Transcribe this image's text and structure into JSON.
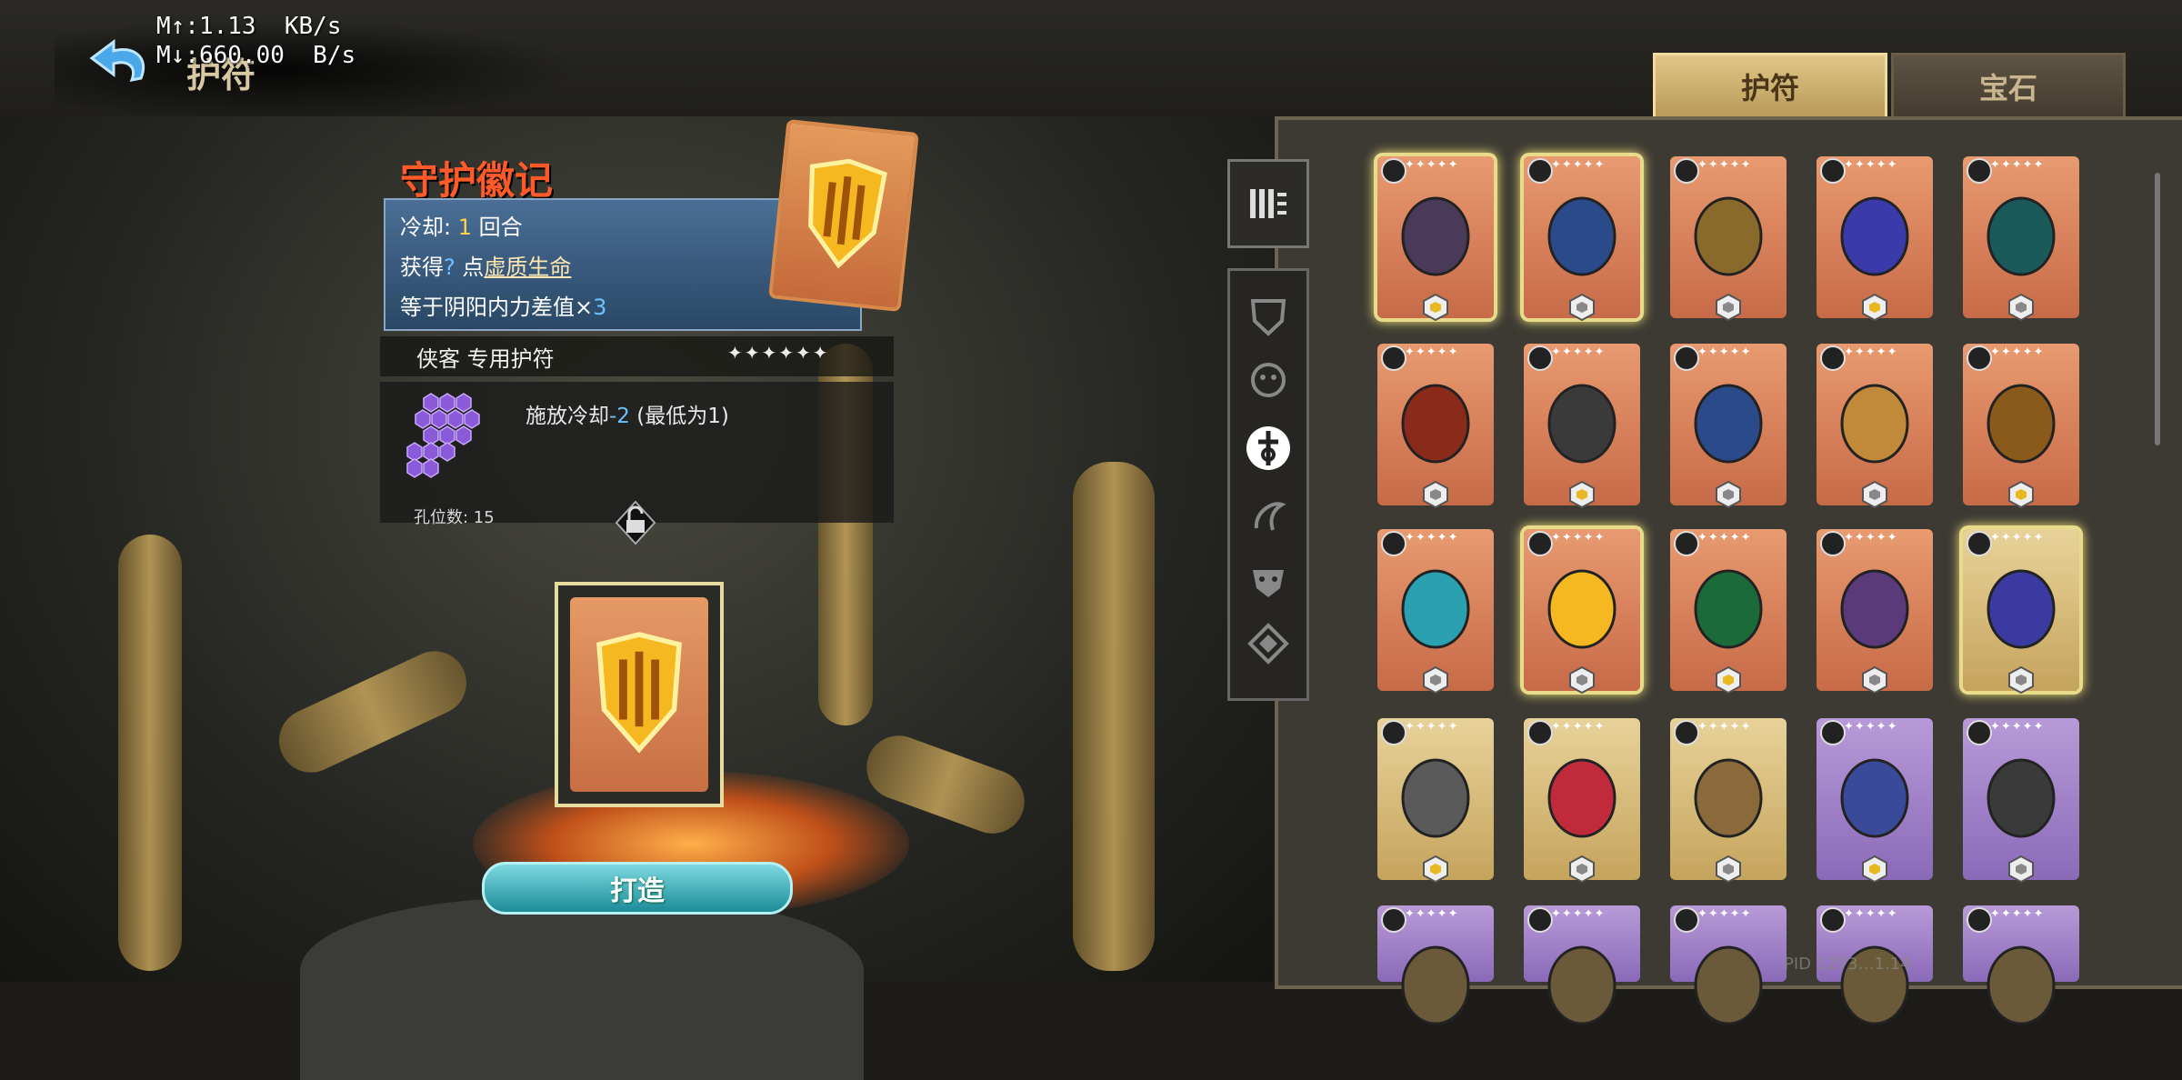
{
  "header": {
    "page_title": "护符",
    "net_up": "M↑:1.13  KB/s",
    "net_down": "M↓:660.00  B/s"
  },
  "tabs": [
    {
      "label": "护符",
      "active": true
    },
    {
      "label": "宝石",
      "active": false
    }
  ],
  "item": {
    "name": "守护徽记",
    "cooldown_label": "冷却:",
    "cooldown_value": "1",
    "cooldown_unit": "回合",
    "gain_label": "获得",
    "gain_value": "?",
    "gain_mid": "点",
    "gain_stat": "虚质生命",
    "equal_text": "等于阴阳内力差值×",
    "equal_value": "3",
    "owner": "侠客 专用护符",
    "stars": "✦✦✦✦✦✦",
    "socket_effect_prefix": "施放冷却",
    "socket_effect_value": "-2",
    "socket_effect_suffix": "(最低为1)",
    "slot_label": "孔位数: 15"
  },
  "forge_button": "打造",
  "filter_icons": [
    "all-filter-icon",
    "shield-class-icon",
    "beast-class-icon",
    "swordsman-class-icon",
    "musician-class-icon",
    "mask-class-icon",
    "diamond-class-icon"
  ],
  "grid": [
    {
      "name": "mask",
      "color": "orange",
      "selected": true
    },
    {
      "name": "blue-book",
      "color": "orange",
      "selected": true
    },
    {
      "name": "gold-helmet",
      "color": "orange",
      "selected": false
    },
    {
      "name": "glowing-tome",
      "color": "orange",
      "selected": false
    },
    {
      "name": "jade-pendant",
      "color": "orange",
      "selected": false
    },
    {
      "name": "red-vest",
      "color": "orange",
      "selected": false
    },
    {
      "name": "bead-necklace",
      "color": "orange",
      "selected": false
    },
    {
      "name": "blue-book-2",
      "color": "orange",
      "selected": false
    },
    {
      "name": "amber-necklace",
      "color": "orange",
      "selected": false
    },
    {
      "name": "gold-bracelet",
      "color": "orange",
      "selected": false
    },
    {
      "name": "teal-feather",
      "color": "orange",
      "selected": false
    },
    {
      "name": "guardian-emblem",
      "color": "orange",
      "selected": true
    },
    {
      "name": "green-token",
      "color": "orange",
      "selected": false
    },
    {
      "name": "purple-skull",
      "color": "orange",
      "selected": false
    },
    {
      "name": "crow-book",
      "color": "gold",
      "selected": true
    },
    {
      "name": "toad",
      "color": "gold",
      "selected": false
    },
    {
      "name": "life-ring",
      "color": "gold",
      "selected": false
    },
    {
      "name": "horn",
      "color": "gold",
      "selected": false
    },
    {
      "name": "purple-book",
      "color": "purple",
      "selected": false
    },
    {
      "name": "staff",
      "color": "purple",
      "selected": false
    },
    {
      "name": "row5-1",
      "color": "purple",
      "selected": false
    },
    {
      "name": "row5-2",
      "color": "purple",
      "selected": false
    },
    {
      "name": "row5-3",
      "color": "purple",
      "selected": false
    },
    {
      "name": "row5-4",
      "color": "purple",
      "selected": false
    },
    {
      "name": "row5-5",
      "color": "purple",
      "selected": false
    }
  ],
  "card_stars": "✦✦✦✦✦",
  "pid_text": "PID 1273…1.14"
}
